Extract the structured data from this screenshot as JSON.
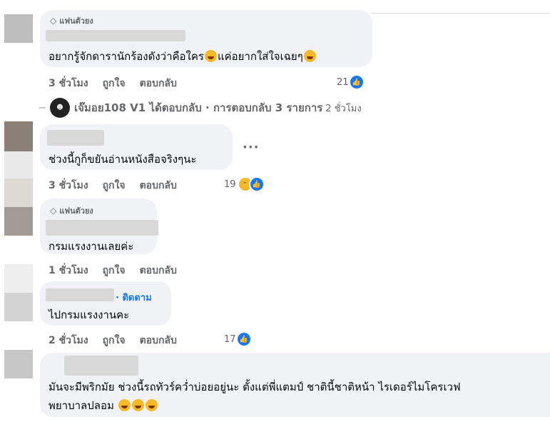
{
  "badges": {
    "top_fan": "แฟนตัวยง"
  },
  "comments": [
    {
      "text": "อยากรู้จักดารานักร้องดังว่าคือใคร",
      "text_after": "แค่อยากใส่ใจเฉยๆ",
      "time": "3 ชั่วโมง",
      "like": "ถูกใจ",
      "reply": "ตอบกลับ",
      "reaction_count": "21"
    },
    {
      "text": "ช่วงนี้กูก็ขยันอ่านหนังสือจริงๆนะ",
      "time": "3 ชั่วโมง",
      "like": "ถูกใจ",
      "reply": "ตอบกลับ",
      "reaction_count": "19"
    },
    {
      "text": "กรมแรงงานเลยค่ะ",
      "time": "1 ชั่วโมง",
      "like": "ถูกใจ",
      "reply": "ตอบกลับ"
    },
    {
      "follow": "· ติดตาม",
      "text": "ไปกรมแรงงานคะ",
      "time": "2 ชั่วโมง",
      "like": "ถูกใจ",
      "reply": "ตอบกลับ",
      "reaction_count": "17"
    },
    {
      "text_line1": "มันจะมีพริกมัย ช่วงนี้รถทัวร์คว่ำบ่อยอยู่นะ ตั้งแต่พี่แตมป์ ชาตินี้ชาติหน้า ไรเดอร์ไมโครเวฟ",
      "text_line2": "พยาบาลปลอม"
    }
  ],
  "replies_summary": {
    "name": "เจ๊มอย108 V1",
    "action": "ได้ตอบกลับ",
    "separator": "·",
    "count_text": "การตอบกลับ 3 รายการ",
    "time": "2 ชั่วโมง"
  },
  "colors": {
    "bubble": "#f0f2f5",
    "like_blue": "#1877f2",
    "meta_gray": "#65676b"
  }
}
